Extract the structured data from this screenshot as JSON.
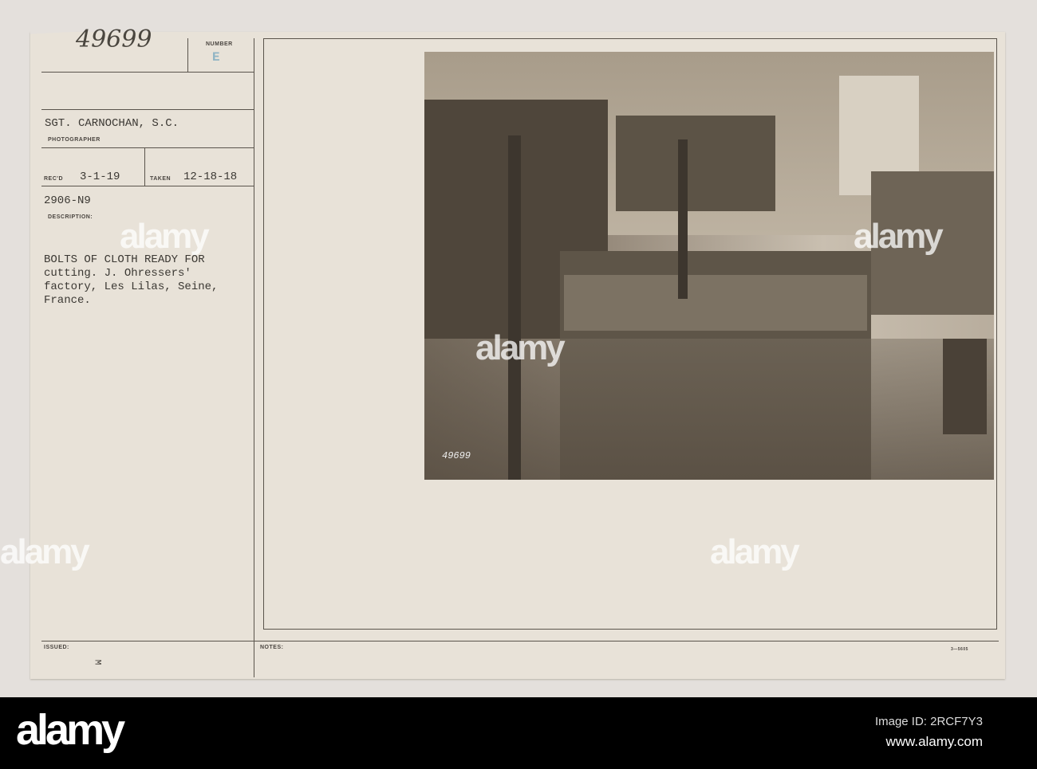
{
  "card": {
    "number_handwritten": "49699",
    "number_label": "NUMBER",
    "number_stamp": "E",
    "photographer": "SGT. CARNOCHAN, S.C.",
    "photographer_label": "PHOTOGRAPHER",
    "received_label": "REC'D",
    "received_date": "3-1-19",
    "taken_label": "TAKEN",
    "taken_date": "12-18-18",
    "file_code": "2906-N9",
    "description_label": "DESCRIPTION:",
    "description": [
      "BOLTS OF CLOTH READY FOR",
      "cutting.  J. Ohressers'",
      "factory, Les Lilas, Seine,",
      "France."
    ],
    "issued_label": "ISSUED:",
    "issued_mark": "M",
    "notes_label": "NOTES:",
    "form_code": "3—5605",
    "photo_number": "49699"
  },
  "watermark": {
    "logo": "alamy",
    "image_id": "Image ID: 2RCF7Y3",
    "url": "www.alamy.com"
  }
}
